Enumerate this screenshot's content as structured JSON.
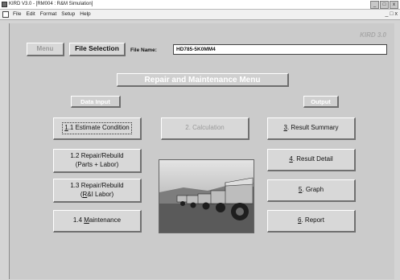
{
  "window": {
    "title": "KIRD V3.0 - [RM004 : R&M Simulation]",
    "minimize": "_",
    "maximize": "□",
    "close": "x"
  },
  "menubar": {
    "items": [
      "File",
      "Edit",
      "Format",
      "Setup",
      "Help"
    ],
    "mdi_buttons": "_ □ x"
  },
  "brand": "KIRD 3.0",
  "toolbar": {
    "menu_label": "Menu",
    "file_selection_label": "File Selection",
    "file_name_label": "File Name:",
    "file_name_value": "HD785-5K0MM4"
  },
  "header": "Repair and Maintenance Menu",
  "data_input": {
    "label": "Data Input",
    "btn_1_1_num": "1",
    "btn_1_1_rest": ".1 Estimate Condition",
    "btn_1_2_line1": "1.2 Repair/Rebuild",
    "btn_1_2_line2": "(Parts + Labor)",
    "btn_1_3_line1": "1.3 Repair/Rebuild",
    "btn_1_3_line2_pre": "(",
    "btn_1_3_line2_u": "R",
    "btn_1_3_line2_post": "&I Labor)",
    "btn_1_4_pre": "1.4 ",
    "btn_1_4_u": "M",
    "btn_1_4_post": "aintenance"
  },
  "calculation": {
    "label": "2. Calculation"
  },
  "output": {
    "label": "Output",
    "btn_3_u": "3",
    "btn_3_rest": ". Result Summary",
    "btn_4_u": "4",
    "btn_4_rest": ". Result Detail",
    "btn_5_u": "5",
    "btn_5_rest": ". Graph",
    "btn_6_u": "6",
    "btn_6_rest": ". Report"
  },
  "colors": {
    "panel_bg": "#cbcbcb",
    "button_face": "#d8d8d8",
    "disabled_text": "#9a9a9a",
    "label_text": "#ffffff"
  }
}
